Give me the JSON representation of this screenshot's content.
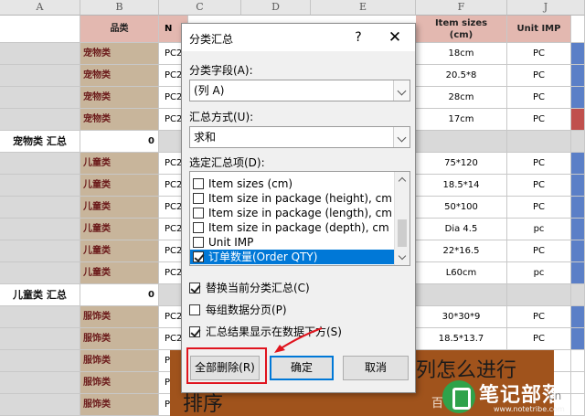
{
  "spreadsheet": {
    "column_headers": [
      "A",
      "B",
      "C",
      "D",
      "E",
      "F",
      "J"
    ],
    "header_row": {
      "b": "品类",
      "c": "N",
      "f_line1": "Item sizes",
      "f_line2": "(cm)",
      "j": "Unit IMP"
    },
    "rows": [
      {
        "b": "宠物类",
        "c": "PC2",
        "f": "18cm",
        "j": "PC",
        "k": "blue"
      },
      {
        "b": "宠物类",
        "c": "PC2",
        "f": "20.5*8",
        "j": "PC",
        "k": "blue"
      },
      {
        "b": "宠物类",
        "c": "PC2",
        "f": "28cm",
        "j": "PC",
        "k": "blue"
      },
      {
        "b": "宠物类",
        "c": "PC2",
        "f": "17cm",
        "j": "PC",
        "k": "red"
      },
      {
        "subtotal": true,
        "a": "宠物类 汇总",
        "b": "0"
      },
      {
        "b": "儿童类",
        "c": "PC2",
        "f": "75*120",
        "j": "PC",
        "k": "blue"
      },
      {
        "b": "儿童类",
        "c": "PC2",
        "f": "18.5*14",
        "j": "PC",
        "k": "blue"
      },
      {
        "b": "儿童类",
        "c": "PC2",
        "f": "50*100",
        "j": "PC",
        "k": "blue"
      },
      {
        "b": "儿童类",
        "c": "PC2",
        "f": "Dia 4.5",
        "j": "pc",
        "k": "blue"
      },
      {
        "b": "儿童类",
        "c": "PC2",
        "f": "22*16.5",
        "j": "PC",
        "k": "blue"
      },
      {
        "b": "儿童类",
        "c": "PC2",
        "f": "L60cm",
        "j": "pc",
        "k": "blue"
      },
      {
        "subtotal": true,
        "a": "儿童类 汇总",
        "b": "0"
      },
      {
        "b": "服饰类",
        "c": "PC2",
        "f": "30*30*9",
        "j": "PC",
        "k": "blue"
      },
      {
        "b": "服饰类",
        "c": "PC2",
        "f": "18.5*13.7",
        "j": "PC",
        "k": "blue"
      },
      {
        "b": "服饰类",
        "c": "P",
        "f": "",
        "j": "",
        "k": ""
      },
      {
        "b": "服饰类",
        "c": "P",
        "f": "",
        "j": "",
        "k": ""
      },
      {
        "b": "服饰类",
        "c": "P",
        "f": "",
        "j": "",
        "k": ""
      }
    ]
  },
  "dialog": {
    "title": "分类汇总",
    "help_label": "?",
    "close_label": "✕",
    "group_by_label": "分类字段(A):",
    "group_by_value": "(列 A)",
    "function_label": "汇总方式(U):",
    "function_value": "求和",
    "subtotal_items_label": "选定汇总项(D):",
    "subtotal_items": [
      {
        "label": "Item sizes (cm)",
        "checked": false,
        "selected": false
      },
      {
        "label": "Item size in package (height), cm",
        "checked": false,
        "selected": false
      },
      {
        "label": "Item size in package (length), cm",
        "checked": false,
        "selected": false
      },
      {
        "label": "Item size in package (depth), cm",
        "checked": false,
        "selected": false
      },
      {
        "label": "Unit IMP",
        "checked": false,
        "selected": false
      },
      {
        "label": "订单数量(Order QTY)",
        "checked": true,
        "selected": true
      }
    ],
    "options": [
      {
        "label": "替换当前分类汇总(C)",
        "checked": true
      },
      {
        "label": "每组数据分页(P)",
        "checked": false
      },
      {
        "label": "汇总结果显示在数据下方(S)",
        "checked": true
      }
    ],
    "remove_all_label": "全部删除(R)",
    "ok_label": "确定",
    "cancel_label": "取消"
  },
  "banner": {
    "line1": "列怎么进行",
    "line2": "排序",
    "small": "百"
  },
  "watermark": {
    "text": "笔记部落",
    "url": "www.notetribe.com",
    "suffix": "cn"
  },
  "colors": {
    "category_fill": "#c8b59b",
    "header_fill": "#e3b8b0",
    "selection": "#0078d7",
    "annotation": "#e0141e",
    "banner": "#a0531c"
  }
}
